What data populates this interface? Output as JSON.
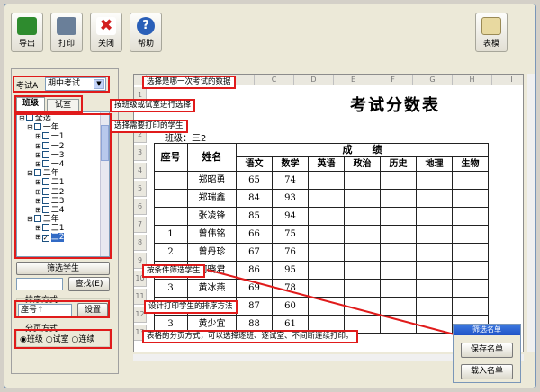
{
  "toolbar": {
    "buttons": [
      {
        "label": "导出",
        "icon": "export-icon",
        "color": "#2e8b2e"
      },
      {
        "label": "打印",
        "icon": "printer-icon",
        "color": "#6a7f99"
      },
      {
        "label": "关闭",
        "icon": "close-icon",
        "color": "#d21f1f"
      },
      {
        "label": "帮助",
        "icon": "help-icon",
        "color": "#2a5fb8"
      }
    ],
    "template_button": {
      "label": "表模",
      "icon": "template-icon"
    }
  },
  "left": {
    "exam_label": "考试A",
    "exam_value": "期中考试",
    "tabs": [
      "班级",
      "试室"
    ],
    "tree": [
      {
        "label": "全选",
        "level": 0,
        "expander": "⊟",
        "checked": false
      },
      {
        "label": "一年",
        "level": 1,
        "expander": "⊟",
        "checked": false
      },
      {
        "label": "一1",
        "level": 2,
        "expander": "⊞",
        "checked": false
      },
      {
        "label": "一2",
        "level": 2,
        "expander": "⊞",
        "checked": false
      },
      {
        "label": "一3",
        "level": 2,
        "expander": "⊞",
        "checked": false
      },
      {
        "label": "一4",
        "level": 2,
        "expander": "⊞",
        "checked": false
      },
      {
        "label": "二年",
        "level": 1,
        "expander": "⊟",
        "checked": false
      },
      {
        "label": "二1",
        "level": 2,
        "expander": "⊞",
        "checked": false
      },
      {
        "label": "二2",
        "level": 2,
        "expander": "⊞",
        "checked": false
      },
      {
        "label": "二3",
        "level": 2,
        "expander": "⊞",
        "checked": false
      },
      {
        "label": "二4",
        "level": 2,
        "expander": "⊞",
        "checked": false
      },
      {
        "label": "三年",
        "level": 1,
        "expander": "⊟",
        "checked": false
      },
      {
        "label": "三1",
        "level": 2,
        "expander": "⊞",
        "checked": false
      },
      {
        "label": "三2",
        "level": 2,
        "expander": "⊞",
        "checked": true
      }
    ],
    "filter_button": "筛选学生",
    "search_placeholder": "",
    "search_button": "查找(E)",
    "sort_group_label": "排序方式",
    "sort_value": "座号↑",
    "sort_button": "设置",
    "page_group_label": "分页方式",
    "page_options": [
      "班级",
      "试室",
      "连续"
    ],
    "page_selected": "班级"
  },
  "callouts": {
    "exam": "选择是哪一次考试的数据",
    "tabs": "按班级或试室进行选择",
    "tree": "选择需要打印的学生",
    "filter": "按条件筛选学生",
    "sort": "设计打印学生的排序方法",
    "paging": "表格的分页方式，可以选择逐班、逐试室、不间断连续打印。"
  },
  "sheet": {
    "col_letters": [
      "C",
      "D",
      "E",
      "F",
      "G",
      "H",
      "I"
    ],
    "row_numbers": [
      "1",
      "2",
      "3",
      "4",
      "5",
      "6",
      "7",
      "8",
      "9",
      "10",
      "11",
      "12",
      "13"
    ],
    "title": "考试分数表",
    "class_label": "班级：三2",
    "headers": {
      "seat": "座号",
      "name": "姓名",
      "scores": "成　　绩"
    },
    "subjects": [
      "语文",
      "数学",
      "英语",
      "政治",
      "历史",
      "地理",
      "生物"
    ],
    "rows": [
      {
        "seat": "",
        "name": "郑昭勇",
        "chinese": "65",
        "math": "74"
      },
      {
        "seat": "",
        "name": "郑瑞鑫",
        "chinese": "84",
        "math": "93"
      },
      {
        "seat": "",
        "name": "张凌锋",
        "chinese": "85",
        "math": "94"
      },
      {
        "seat": "1",
        "name": "曾伟铭",
        "chinese": "66",
        "math": "75"
      },
      {
        "seat": "2",
        "name": "曾丹珍",
        "chinese": "67",
        "math": "76"
      },
      {
        "seat": "",
        "name": "何晓君",
        "chinese": "86",
        "math": "95"
      },
      {
        "seat": "3",
        "name": "黄冰燕",
        "chinese": "69",
        "math": "78"
      },
      {
        "seat": "",
        "name": "张家辉",
        "chinese": "87",
        "math": "60"
      },
      {
        "seat": "3",
        "name": "黄少宜",
        "chinese": "88",
        "math": "61"
      }
    ]
  },
  "popup": {
    "title": "筛选名单",
    "buttons": [
      "保存名单",
      "载入名单"
    ]
  },
  "colors": {
    "annotation_red": "#e01b1b",
    "selection_blue": "#316ac5"
  }
}
